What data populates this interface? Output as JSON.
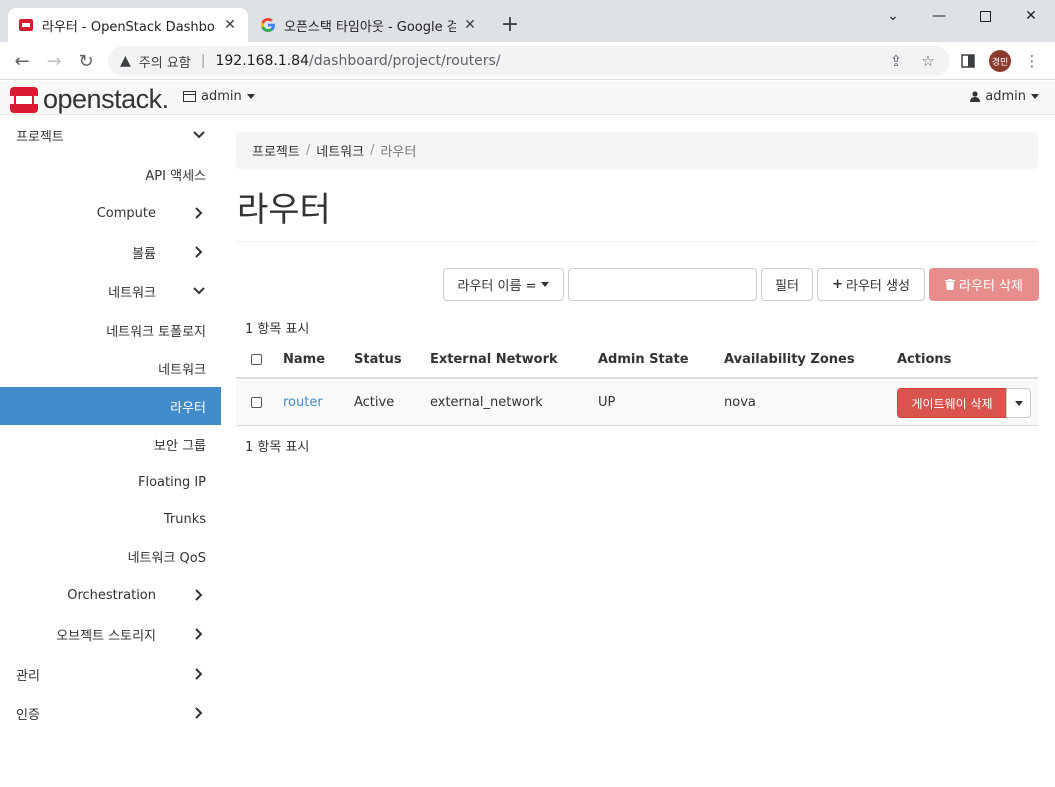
{
  "browser": {
    "tabs": [
      {
        "title": "라우터 - OpenStack Dashboard"
      },
      {
        "title": "오픈스택 타임아웃 - Google 검색"
      }
    ],
    "security_label": "주의 요함",
    "url_host": "192.168.1.84",
    "url_path": "/dashboard/project/routers/",
    "profile_initials": "경민"
  },
  "header": {
    "logo_text": "openstack.",
    "project": "admin",
    "user": "admin"
  },
  "sidebar": {
    "items": [
      {
        "label": "프로젝트"
      },
      {
        "label": "API 액세스"
      },
      {
        "label": "Compute"
      },
      {
        "label": "볼륨"
      },
      {
        "label": "네트워크"
      },
      {
        "label": "네트워크 토폴로지"
      },
      {
        "label": "네트워크"
      },
      {
        "label": "라우터"
      },
      {
        "label": "보안 그룹"
      },
      {
        "label": "Floating IP"
      },
      {
        "label": "Trunks"
      },
      {
        "label": "네트워크 QoS"
      },
      {
        "label": "Orchestration"
      },
      {
        "label": "오브젝트 스토리지"
      },
      {
        "label": "관리"
      },
      {
        "label": "인증"
      }
    ]
  },
  "main": {
    "breadcrumb": [
      "프로젝트",
      "네트워크",
      "라우터"
    ],
    "title": "라우터",
    "filter_field": "라우터 이름 =",
    "filter_button": "필터",
    "create_button": "라우터 생성",
    "delete_button": "라우터 삭제",
    "count_top": "1 항목 표시",
    "count_bottom": "1 항목 표시",
    "table": {
      "headers": [
        "Name",
        "Status",
        "External Network",
        "Admin State",
        "Availability Zones",
        "Actions"
      ],
      "rows": [
        {
          "name": "router",
          "status": "Active",
          "external_network": "external_network",
          "admin_state": "UP",
          "availability_zone": "nova",
          "action": "게이트웨이 삭제"
        }
      ]
    }
  },
  "colors": {
    "accent": "#428bca",
    "danger": "#d9534f",
    "danger_disabled": "#e78e8c",
    "logo_red": "#da1a32"
  }
}
